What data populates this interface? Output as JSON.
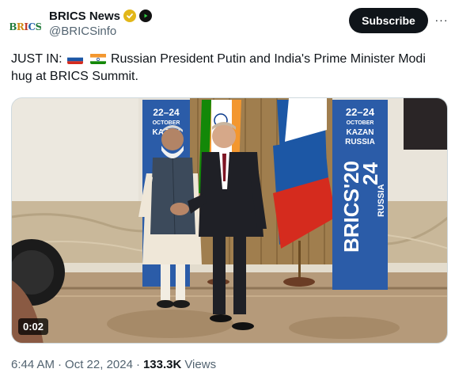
{
  "account": {
    "display_name": "BRICS News",
    "handle": "@BRICSinfo",
    "avatar_text": [
      "B",
      "R",
      "I",
      "C",
      "S"
    ]
  },
  "subscribe_label": "Subscribe",
  "more_label": "···",
  "tweet": {
    "prefix": "JUST IN:",
    "text": "Russian President Putin and India's Prime Minister Modi hug at BRICS Summit."
  },
  "video": {
    "duration": "0:02",
    "banner_left": {
      "date": "22–24",
      "month": "OCTOBER",
      "city": "KAZAN"
    },
    "banner_right": {
      "date": "22–24",
      "month": "OCTOBER",
      "city": "KAZAN",
      "country": "RUSSIA",
      "vertical_text": "BRICS'20",
      "vertical_year": "24",
      "vertical_country": "RUSSIA"
    }
  },
  "meta": {
    "time": "6:44 AM",
    "separator": "·",
    "date": "Oct 22, 2024",
    "views_count": "133.3K",
    "views_label": "Views"
  },
  "colors": {
    "subscribe_bg": "#0f1419",
    "verified_badge": "#e2b719",
    "banner_blue": "#2b5ca8",
    "muted_text": "#536471"
  },
  "icons": {
    "verified": "gold-check-badge-icon",
    "affiliate": "play-badge-icon",
    "more": "more-dots-icon"
  }
}
